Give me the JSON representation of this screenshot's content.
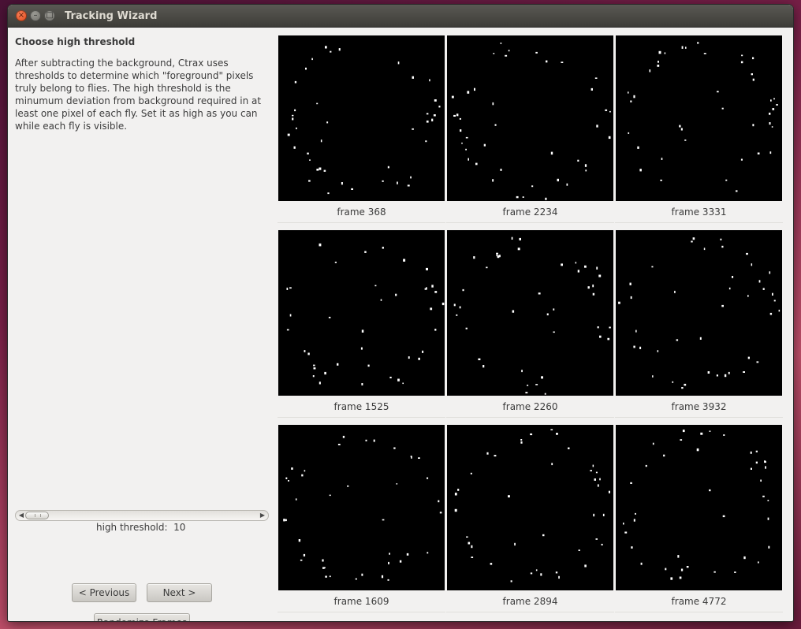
{
  "window": {
    "title": "Tracking Wizard",
    "close_glyph": "×",
    "minimize_glyph": "–",
    "maximize_glyph": "□"
  },
  "panel": {
    "heading": "Choose high threshold",
    "description": "After subtracting the background, Ctrax uses thresholds to determine which \"foreground\" pixels truly belong to flies. The high threshold is the minumum deviation from background required in at least one pixel of each fly. Set it as high as you can while each fly is visible.",
    "threshold_label": "high threshold:  10",
    "threshold_value": 10
  },
  "buttons": {
    "previous": "< Previous",
    "next": "Next >",
    "randomize": "Randomize Frames"
  },
  "frames": [
    {
      "caption": "frame 368"
    },
    {
      "caption": "frame 2234"
    },
    {
      "caption": "frame 3331"
    },
    {
      "caption": "frame 1525"
    },
    {
      "caption": "frame 2260"
    },
    {
      "caption": "frame 3932"
    },
    {
      "caption": "frame 1609"
    },
    {
      "caption": "frame 2894"
    },
    {
      "caption": "frame 4772"
    }
  ],
  "colors": {
    "frame_background": "#000000",
    "fly_pixel": "#ffffff",
    "window_background": "#f2f1f0"
  }
}
